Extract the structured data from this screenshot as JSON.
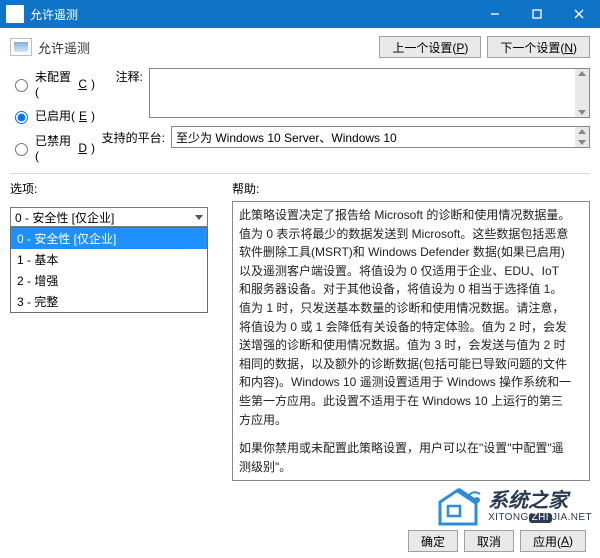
{
  "titlebar": {
    "title": "允许遥测"
  },
  "header": {
    "cfg_name": "允许遥测",
    "prev_btn": "上一个设置(P)",
    "next_btn": "下一个设置(N)"
  },
  "radios": {
    "not_configured": "未配置(C)",
    "enabled": "已启用(E)",
    "disabled": "已禁用(D)",
    "selected": "enabled"
  },
  "labels": {
    "comment": "注释:",
    "supported": "支持的平台:",
    "options": "选项:",
    "help": "帮助:"
  },
  "fields": {
    "comment_value": "",
    "supported_value": "至少为 Windows 10 Server、Windows 10"
  },
  "dropdown": {
    "selected": "0 - 安全性 [仅企业]",
    "items": [
      "0 - 安全性 [仅企业]",
      "1 - 基本",
      "2 - 增强",
      "3 - 完整"
    ]
  },
  "help_text": {
    "p1": "此策略设置决定了报告给 Microsoft 的诊断和使用情况数据量。值为 0 表示将最少的数据发送到 Microsoft。这些数据包括恶意软件删除工具(MSRT)和 Windows Defender 数据(如果已启用)以及遥测客户端设置。将值设为 0 仅适用于企业、EDU、IoT 和服务器设备。对于其他设备，将值设为 0 相当于选择值 1。值为 1 时，只发送基本数量的诊断和使用情况数据。请注意，将值设为 0 或 1 会降低有关设备的特定体验。值为 2 时，会发送增强的诊断和使用情况数据。值为 3 时，会发送与值为 2 时相同的数据，以及额外的诊断数据(包括可能已导致问题的文件和内容)。Windows 10 遥测设置适用于 Windows 操作系统和一些第一方应用。此设置不适用于在 Windows 10 上运行的第三方应用。",
    "p2": "如果你禁用或未配置此策略设置，用户可以在\"设置\"中配置\"遥测级别\"。"
  },
  "footer": {
    "ok": "确定",
    "cancel": "取消",
    "apply": "应用(A)"
  },
  "watermark": {
    "cn": "系统之家",
    "en": "XITONGZHIJIA.NET"
  }
}
